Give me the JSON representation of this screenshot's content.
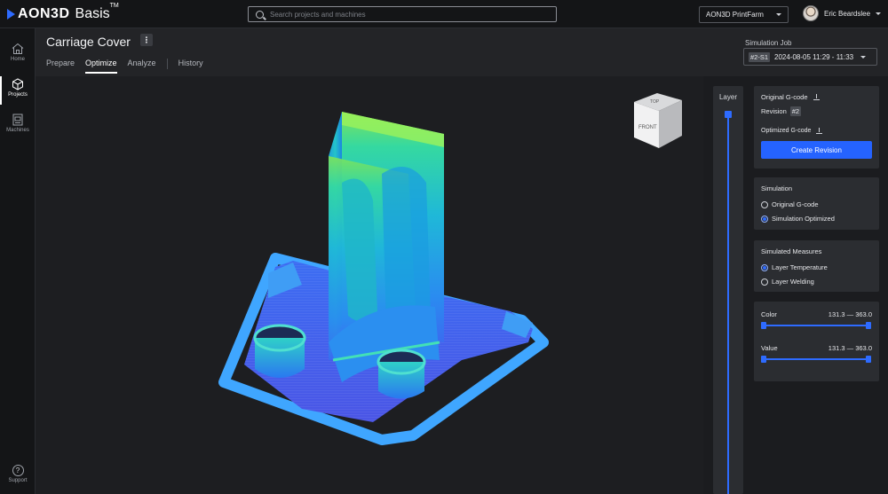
{
  "topbar": {
    "brand": "AON3D",
    "product": "Basis",
    "trademark": "TM",
    "search_placeholder": "Search projects and machines",
    "farm_label": "AON3D PrintFarm",
    "user_name": "Eric Beardslee"
  },
  "leftnav": {
    "items": [
      {
        "label": "Home",
        "icon": "home-icon"
      },
      {
        "label": "Projects",
        "icon": "cube-icon"
      },
      {
        "label": "Machines",
        "icon": "printer-icon"
      }
    ],
    "support_label": "Support",
    "support_icon": "?"
  },
  "header": {
    "title": "Carriage Cover",
    "menu_glyph": "⋮",
    "tabs": [
      {
        "label": "Prepare"
      },
      {
        "label": "Optimize"
      },
      {
        "label": "Analyze"
      },
      {
        "label": "History"
      }
    ],
    "sim_job_label": "Simulation Job",
    "sim_job_badge": "#2-S1",
    "sim_job_value": "2024-08-05 11:29 - 11:33"
  },
  "viewcube": {
    "top_label": "TOP",
    "front_label": "FRONT"
  },
  "layer": {
    "label": "Layer",
    "position_fraction": 1.0
  },
  "gcode_panel": {
    "original_label": "Original G-code",
    "revision_label": "Revision",
    "revision_badge": "#2",
    "optimized_label": "Optimized G-code",
    "create_button": "Create Revision"
  },
  "simulation_panel": {
    "title": "Simulation",
    "options": [
      "Original G-code",
      "Simulation Optimized"
    ],
    "selected": "Simulation Optimized"
  },
  "measures_panel": {
    "title": "Simulated Measures",
    "options": [
      "Layer Temperature",
      "Layer Welding"
    ],
    "selected": "Layer Temperature"
  },
  "range_panel": {
    "color_label": "Color",
    "color_range": "131.3 — 363.0",
    "value_label": "Value",
    "value_range": "131.3 — 363.0"
  },
  "colors": {
    "accent": "#2e6bff",
    "button": "#2563ff",
    "background": "#1d1e21"
  }
}
